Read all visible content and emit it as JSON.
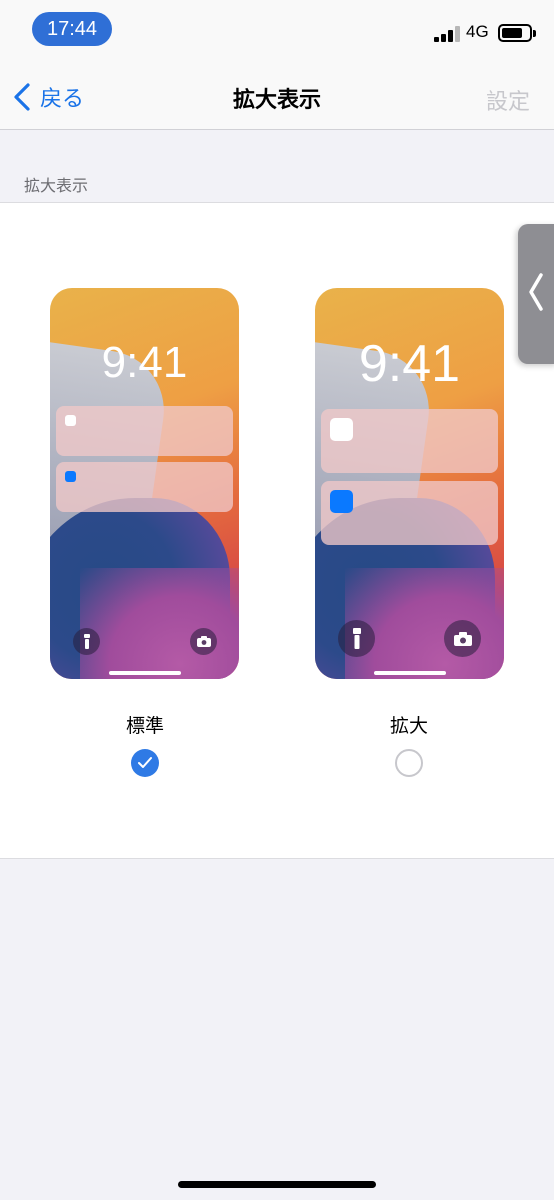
{
  "status_bar": {
    "time": "17:44",
    "network": "4G",
    "signal_bars_active": 3,
    "signal_bars_total": 4,
    "battery_level": 0.65
  },
  "nav": {
    "back_label": "戻る",
    "title": "拡大表示",
    "right_label": "設定"
  },
  "section": {
    "header": "拡大表示"
  },
  "options": [
    {
      "label": "標準",
      "preview_time": "9:41",
      "selected": true
    },
    {
      "label": "拡大",
      "preview_time": "9:41",
      "selected": false
    }
  ],
  "colors": {
    "accent": "#1a73e8",
    "time_pill": "#2f6fd6",
    "radio_selected": "#2f7ae5",
    "disabled_text": "#c7c7cc",
    "notification_blue": "#0a79ff"
  },
  "icons": {
    "back": "chevron-left-icon",
    "flashlight": "flashlight-icon",
    "camera": "camera-icon",
    "check": "checkmark-icon",
    "side_tab": "chevron-left-icon"
  }
}
